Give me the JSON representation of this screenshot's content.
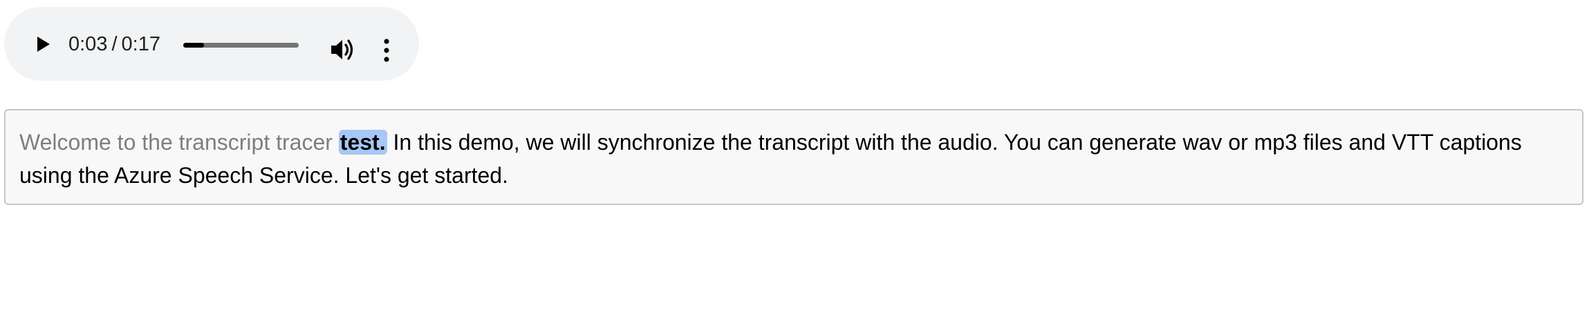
{
  "audio_player": {
    "current_time": "0:03",
    "separator": "/",
    "duration": "0:17",
    "progress_fraction": 0.18,
    "icons": {
      "play": "play-icon",
      "volume": "volume-icon",
      "more": "more-vert-icon"
    },
    "colors": {
      "background": "#f1f3f4",
      "track": "#757575",
      "fill": "#000000"
    }
  },
  "transcript": {
    "spoken": "Welcome to the transcript tracer",
    "current": "test.",
    "upcoming": "In this demo, we will synchronize the transcript with the audio. You can generate wav or mp3 files and VTT captions using the Azure Speech Service. Let's get started.",
    "colors": {
      "spoken": "#7e7e7e",
      "highlight": "#a7c7f6",
      "upcoming": "#000000"
    }
  }
}
